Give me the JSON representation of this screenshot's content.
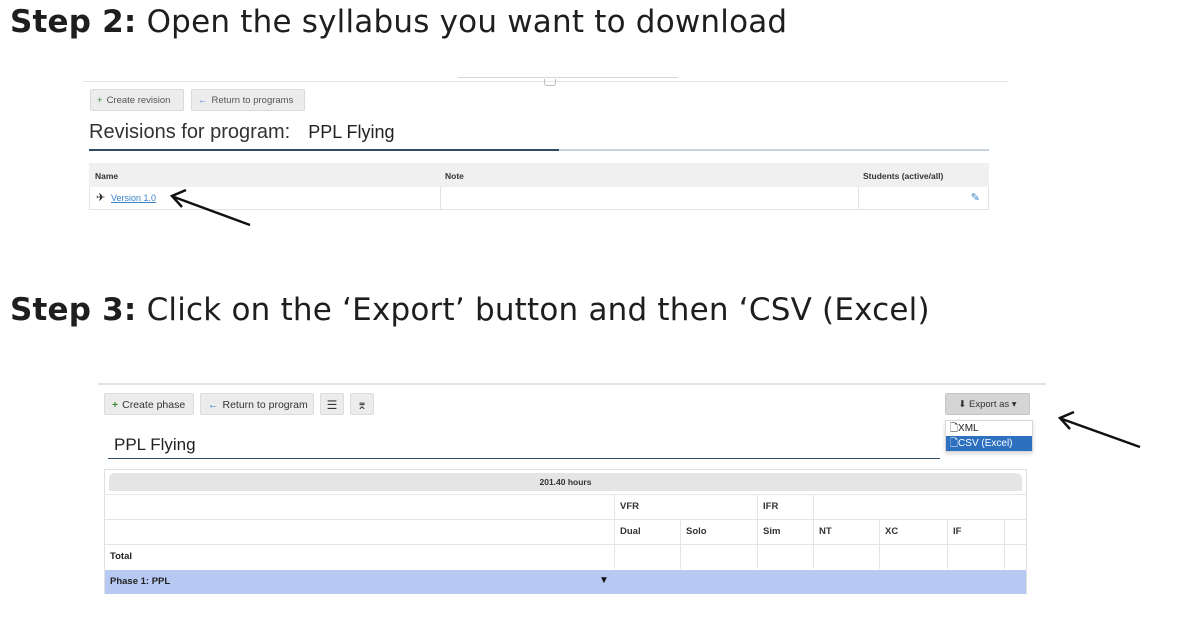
{
  "steps": [
    {
      "prefix": "Step 2:",
      "text": " Open the syllabus you want to download"
    },
    {
      "prefix": "Step 3:",
      "text": " Click on the ‘Export’ button and then ‘CSV (Excel)"
    }
  ],
  "revisions_view": {
    "buttons": {
      "create": "Create revision",
      "return": "Return to programs"
    },
    "title": "Revisions for program:",
    "program_name": "PPL Flying",
    "columns": [
      "Name",
      "Note",
      "Students (active/all)"
    ],
    "rows": [
      {
        "name": "Version 1.0",
        "note": "",
        "students": ""
      }
    ],
    "icons": {
      "create": "plus-icon",
      "return": "arrow-left-icon",
      "row": "plane-icon",
      "edit": "pencil-icon"
    }
  },
  "program_view": {
    "buttons": {
      "create": "Create phase",
      "return": "Return to program",
      "export": "Export as"
    },
    "export_menu": [
      "XML",
      "CSV (Excel)"
    ],
    "selected_export": "CSV (Excel)",
    "title": "PPL Flying",
    "total_hours": "201.40 hours",
    "group_headers": [
      "VFR",
      "IFR"
    ],
    "sub_headers": [
      "Dual",
      "Solo",
      "Sim",
      "NT",
      "XC",
      "IF"
    ],
    "rows": [
      "Total",
      "Phase 1: PPL"
    ],
    "accent_color": "#2c70bf",
    "phase_row_color": "#b7c8f3"
  }
}
